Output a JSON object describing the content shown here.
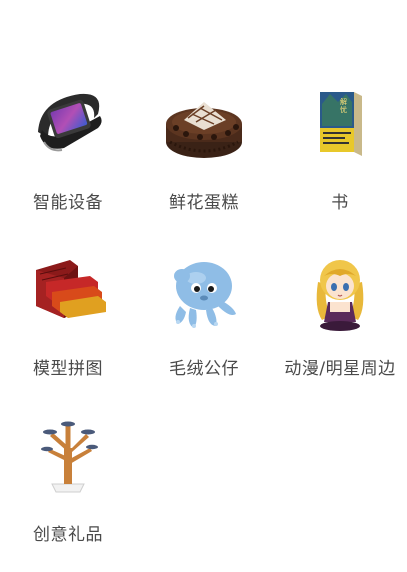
{
  "categories": [
    {
      "label": "智能设备",
      "icon": "smart-band-icon"
    },
    {
      "label": "鲜花蛋糕",
      "icon": "chocolate-cake-icon"
    },
    {
      "label": "书",
      "icon": "book-icon"
    },
    {
      "label": "模型拼图",
      "icon": "model-puzzle-icon"
    },
    {
      "label": "毛绒公仔",
      "icon": "octopus-plush-icon"
    },
    {
      "label": "动漫/明星周边",
      "icon": "anime-figure-icon"
    },
    {
      "label": "创意礼品",
      "icon": "creative-gift-icon"
    }
  ]
}
